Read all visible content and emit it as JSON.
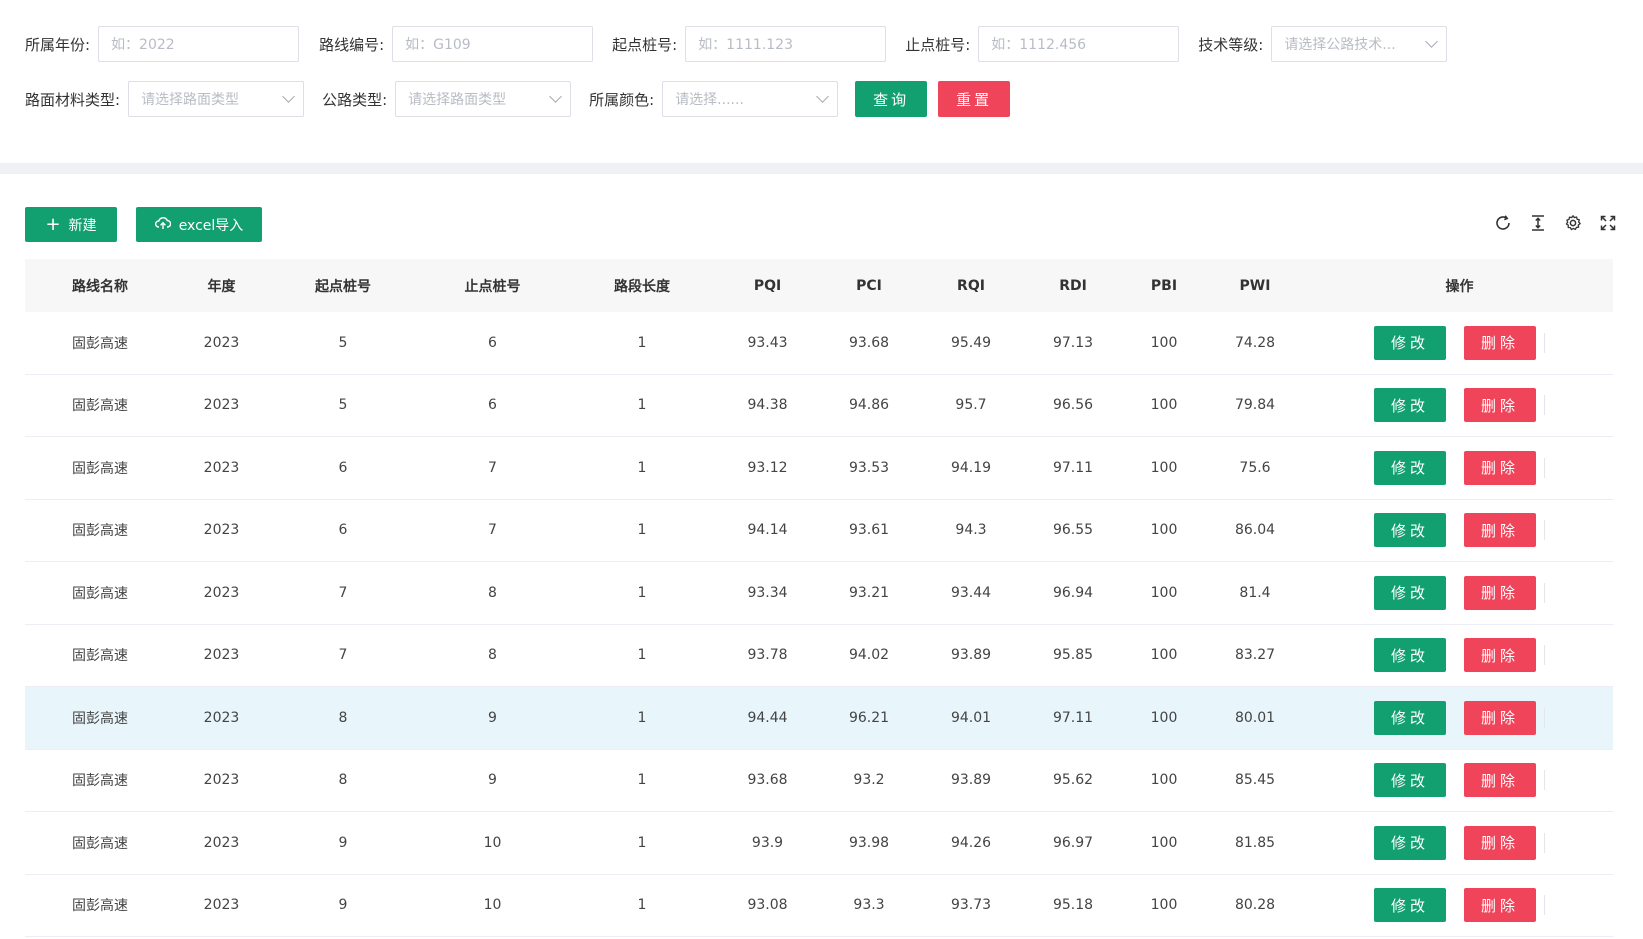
{
  "filters": {
    "year": {
      "label": "所属年份:",
      "placeholder": "如：2022"
    },
    "route_code": {
      "label": "路线编号:",
      "placeholder": "如：G109"
    },
    "start_stake": {
      "label": "起点桩号:",
      "placeholder": "如：1111.123"
    },
    "end_stake": {
      "label": "止点桩号:",
      "placeholder": "如：1112.456"
    },
    "tech_grade": {
      "label": "技术等级:",
      "placeholder": "请选择公路技术..."
    },
    "surface_type": {
      "label": "路面材料类型:",
      "placeholder": "请选择路面类型"
    },
    "road_type": {
      "label": "公路类型:",
      "placeholder": "请选择路面类型"
    },
    "color": {
      "label": "所属颜色:",
      "placeholder": "请选择......"
    },
    "query_label": "查询",
    "reset_label": "重置"
  },
  "toolbar": {
    "new_label": "新建",
    "import_label": "excel导入",
    "icons": [
      "refresh-icon",
      "column-height-icon",
      "settings-icon",
      "fullscreen-icon"
    ]
  },
  "table": {
    "columns": [
      "路线名称",
      "年度",
      "起点桩号",
      "止点桩号",
      "路段长度",
      "PQI",
      "PCI",
      "RQI",
      "RDI",
      "PBI",
      "PWI",
      "操作"
    ],
    "edit_label": "修改",
    "delete_label": "删除",
    "rows": [
      {
        "name": "固彭高速",
        "year": "2023",
        "start": "5",
        "end": "6",
        "length": "1",
        "pqi": "93.43",
        "pci": "93.68",
        "rqi": "95.49",
        "rdi": "97.13",
        "pbi": "100",
        "pwi": "74.28"
      },
      {
        "name": "固彭高速",
        "year": "2023",
        "start": "5",
        "end": "6",
        "length": "1",
        "pqi": "94.38",
        "pci": "94.86",
        "rqi": "95.7",
        "rdi": "96.56",
        "pbi": "100",
        "pwi": "79.84"
      },
      {
        "name": "固彭高速",
        "year": "2023",
        "start": "6",
        "end": "7",
        "length": "1",
        "pqi": "93.12",
        "pci": "93.53",
        "rqi": "94.19",
        "rdi": "97.11",
        "pbi": "100",
        "pwi": "75.6"
      },
      {
        "name": "固彭高速",
        "year": "2023",
        "start": "6",
        "end": "7",
        "length": "1",
        "pqi": "94.14",
        "pci": "93.61",
        "rqi": "94.3",
        "rdi": "96.55",
        "pbi": "100",
        "pwi": "86.04"
      },
      {
        "name": "固彭高速",
        "year": "2023",
        "start": "7",
        "end": "8",
        "length": "1",
        "pqi": "93.34",
        "pci": "93.21",
        "rqi": "93.44",
        "rdi": "96.94",
        "pbi": "100",
        "pwi": "81.4"
      },
      {
        "name": "固彭高速",
        "year": "2023",
        "start": "7",
        "end": "8",
        "length": "1",
        "pqi": "93.78",
        "pci": "94.02",
        "rqi": "93.89",
        "rdi": "95.85",
        "pbi": "100",
        "pwi": "83.27"
      },
      {
        "name": "固彭高速",
        "year": "2023",
        "start": "8",
        "end": "9",
        "length": "1",
        "pqi": "94.44",
        "pci": "96.21",
        "rqi": "94.01",
        "rdi": "97.11",
        "pbi": "100",
        "pwi": "80.01",
        "highlighted": true
      },
      {
        "name": "固彭高速",
        "year": "2023",
        "start": "8",
        "end": "9",
        "length": "1",
        "pqi": "93.68",
        "pci": "93.2",
        "rqi": "93.89",
        "rdi": "95.62",
        "pbi": "100",
        "pwi": "85.45"
      },
      {
        "name": "固彭高速",
        "year": "2023",
        "start": "9",
        "end": "10",
        "length": "1",
        "pqi": "93.9",
        "pci": "93.98",
        "rqi": "94.26",
        "rdi": "96.97",
        "pbi": "100",
        "pwi": "81.85"
      },
      {
        "name": "固彭高速",
        "year": "2023",
        "start": "9",
        "end": "10",
        "length": "1",
        "pqi": "93.08",
        "pci": "93.3",
        "rqi": "93.73",
        "rdi": "95.18",
        "pbi": "100",
        "pwi": "80.28"
      }
    ]
  },
  "colors": {
    "primary": "#13a071",
    "danger": "#f0445a",
    "row_highlight": "#e8f6fc",
    "header_bg": "#f7f7f8"
  }
}
